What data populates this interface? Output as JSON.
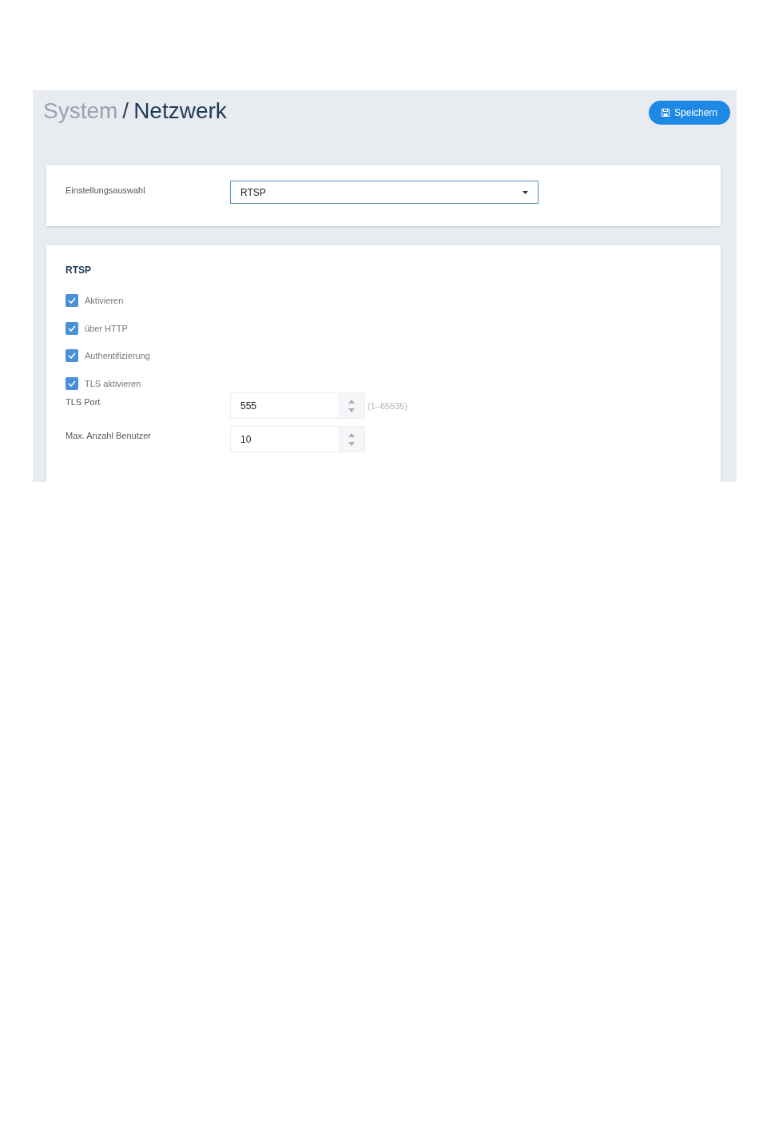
{
  "breadcrumb": {
    "parent": "System",
    "separator": "/",
    "current": "Netzwerk"
  },
  "save_button": {
    "label": "Speichern"
  },
  "selection": {
    "label": "Einstellungsauswahl",
    "value": "RTSP"
  },
  "section": {
    "title": "RTSP",
    "checkboxes": [
      {
        "label": "Aktivieren",
        "checked": true
      },
      {
        "label": "über HTTP",
        "checked": true
      },
      {
        "label": "Authentifizierung",
        "checked": true
      },
      {
        "label": "TLS aktivieren",
        "checked": true
      }
    ],
    "fields": [
      {
        "label": "TLS Port",
        "value": "555",
        "hint": "(1–65535)"
      },
      {
        "label": "Max. Anzahl Benutzer",
        "value": "10"
      }
    ]
  }
}
